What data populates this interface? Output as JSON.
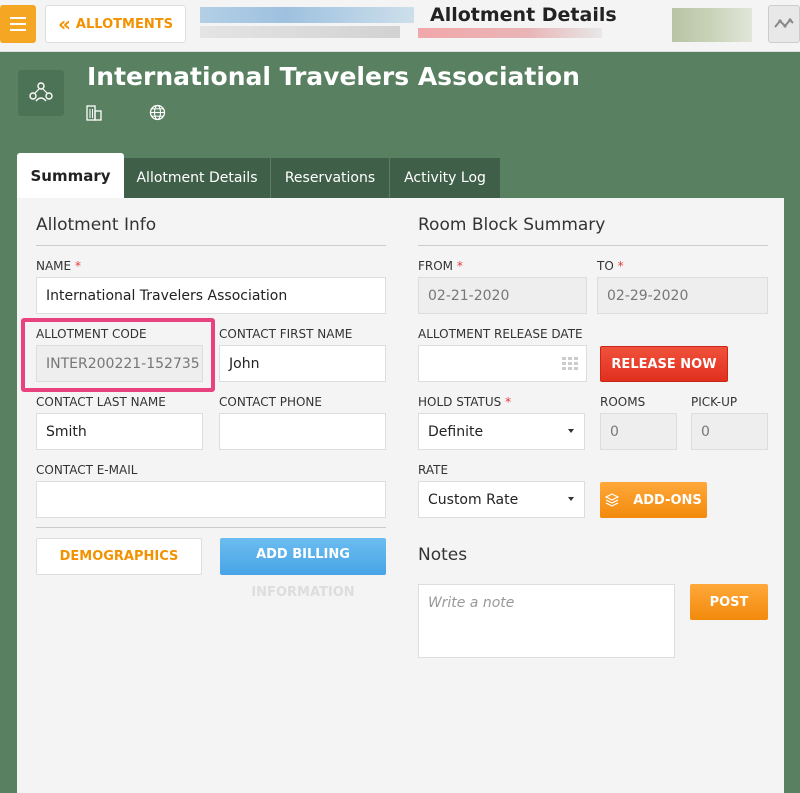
{
  "topbar": {
    "back_label": "ALLOTMENTS",
    "page_title": "Allotment Details"
  },
  "header": {
    "org_name": "International Travelers Association"
  },
  "tabs": [
    {
      "label": "Summary",
      "active": true
    },
    {
      "label": "Allotment Details",
      "active": false
    },
    {
      "label": "Reservations",
      "active": false
    },
    {
      "label": "Activity Log",
      "active": false
    }
  ],
  "allotment_info": {
    "title": "Allotment Info",
    "name_label": "NAME",
    "name_value": "International Travelers Association",
    "code_label": "ALLOTMENT CODE",
    "code_value": "INTER200221-152735",
    "first_name_label": "CONTACT FIRST NAME",
    "first_name_value": "John",
    "last_name_label": "CONTACT LAST NAME",
    "last_name_value": "Smith",
    "phone_label": "CONTACT PHONE",
    "phone_value": "",
    "email_label": "CONTACT E-MAIL",
    "email_value": "",
    "demographics_label": "DEMOGRAPHICS",
    "billing_label_1": "ADD BILLING",
    "billing_label_2": "INFORMATION"
  },
  "room_block": {
    "title": "Room Block Summary",
    "from_label": "FROM",
    "from_value": "02-21-2020",
    "to_label": "TO",
    "to_value": "02-29-2020",
    "release_date_label": "ALLOTMENT RELEASE DATE",
    "release_date_value": "",
    "release_now_label": "RELEASE NOW",
    "hold_status_label": "HOLD STATUS",
    "hold_status_value": "Definite",
    "rooms_label": "ROOMS",
    "rooms_value": "0",
    "pickup_label": "PICK-UP",
    "pickup_value": "0",
    "rate_label": "RATE",
    "rate_value": "Custom Rate",
    "addons_label": "ADD-ONS"
  },
  "notes": {
    "title": "Notes",
    "placeholder": "Write a note",
    "post_label": "POST"
  },
  "colors": {
    "background": "#5a8062",
    "accent_orange": "#f39200",
    "release_red": "#e0301e",
    "billing_blue": "#48a4e6",
    "highlight_pink": "#e8437e"
  }
}
